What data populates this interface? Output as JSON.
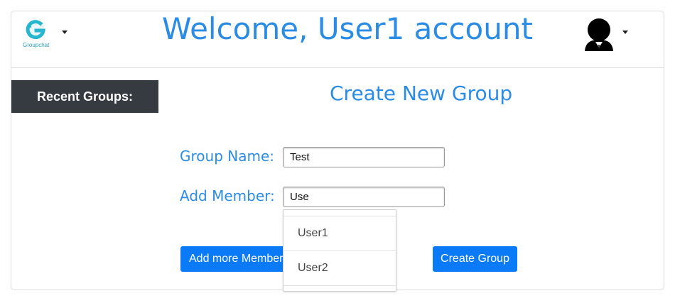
{
  "header": {
    "welcome": "Welcome, User1 account",
    "logo_icon": "groupchat-logo-icon",
    "logo_text": "Groupchat",
    "avatar_icon": "user-avatar-icon"
  },
  "sidebar": {
    "recent_groups_label": "Recent Groups:"
  },
  "form": {
    "title": "Create New Group",
    "group_name_label": "Group Name:",
    "group_name_value": "Test",
    "add_member_label": "Add Member:",
    "add_member_value": "Use",
    "suggestions": [
      "User1",
      "User2"
    ],
    "add_more_button": "Add more Members",
    "create_button": "Create Group"
  },
  "colors": {
    "accent_text": "#2b8ce6",
    "button": "#0b7af7",
    "sidebar_bg": "#353b40"
  }
}
